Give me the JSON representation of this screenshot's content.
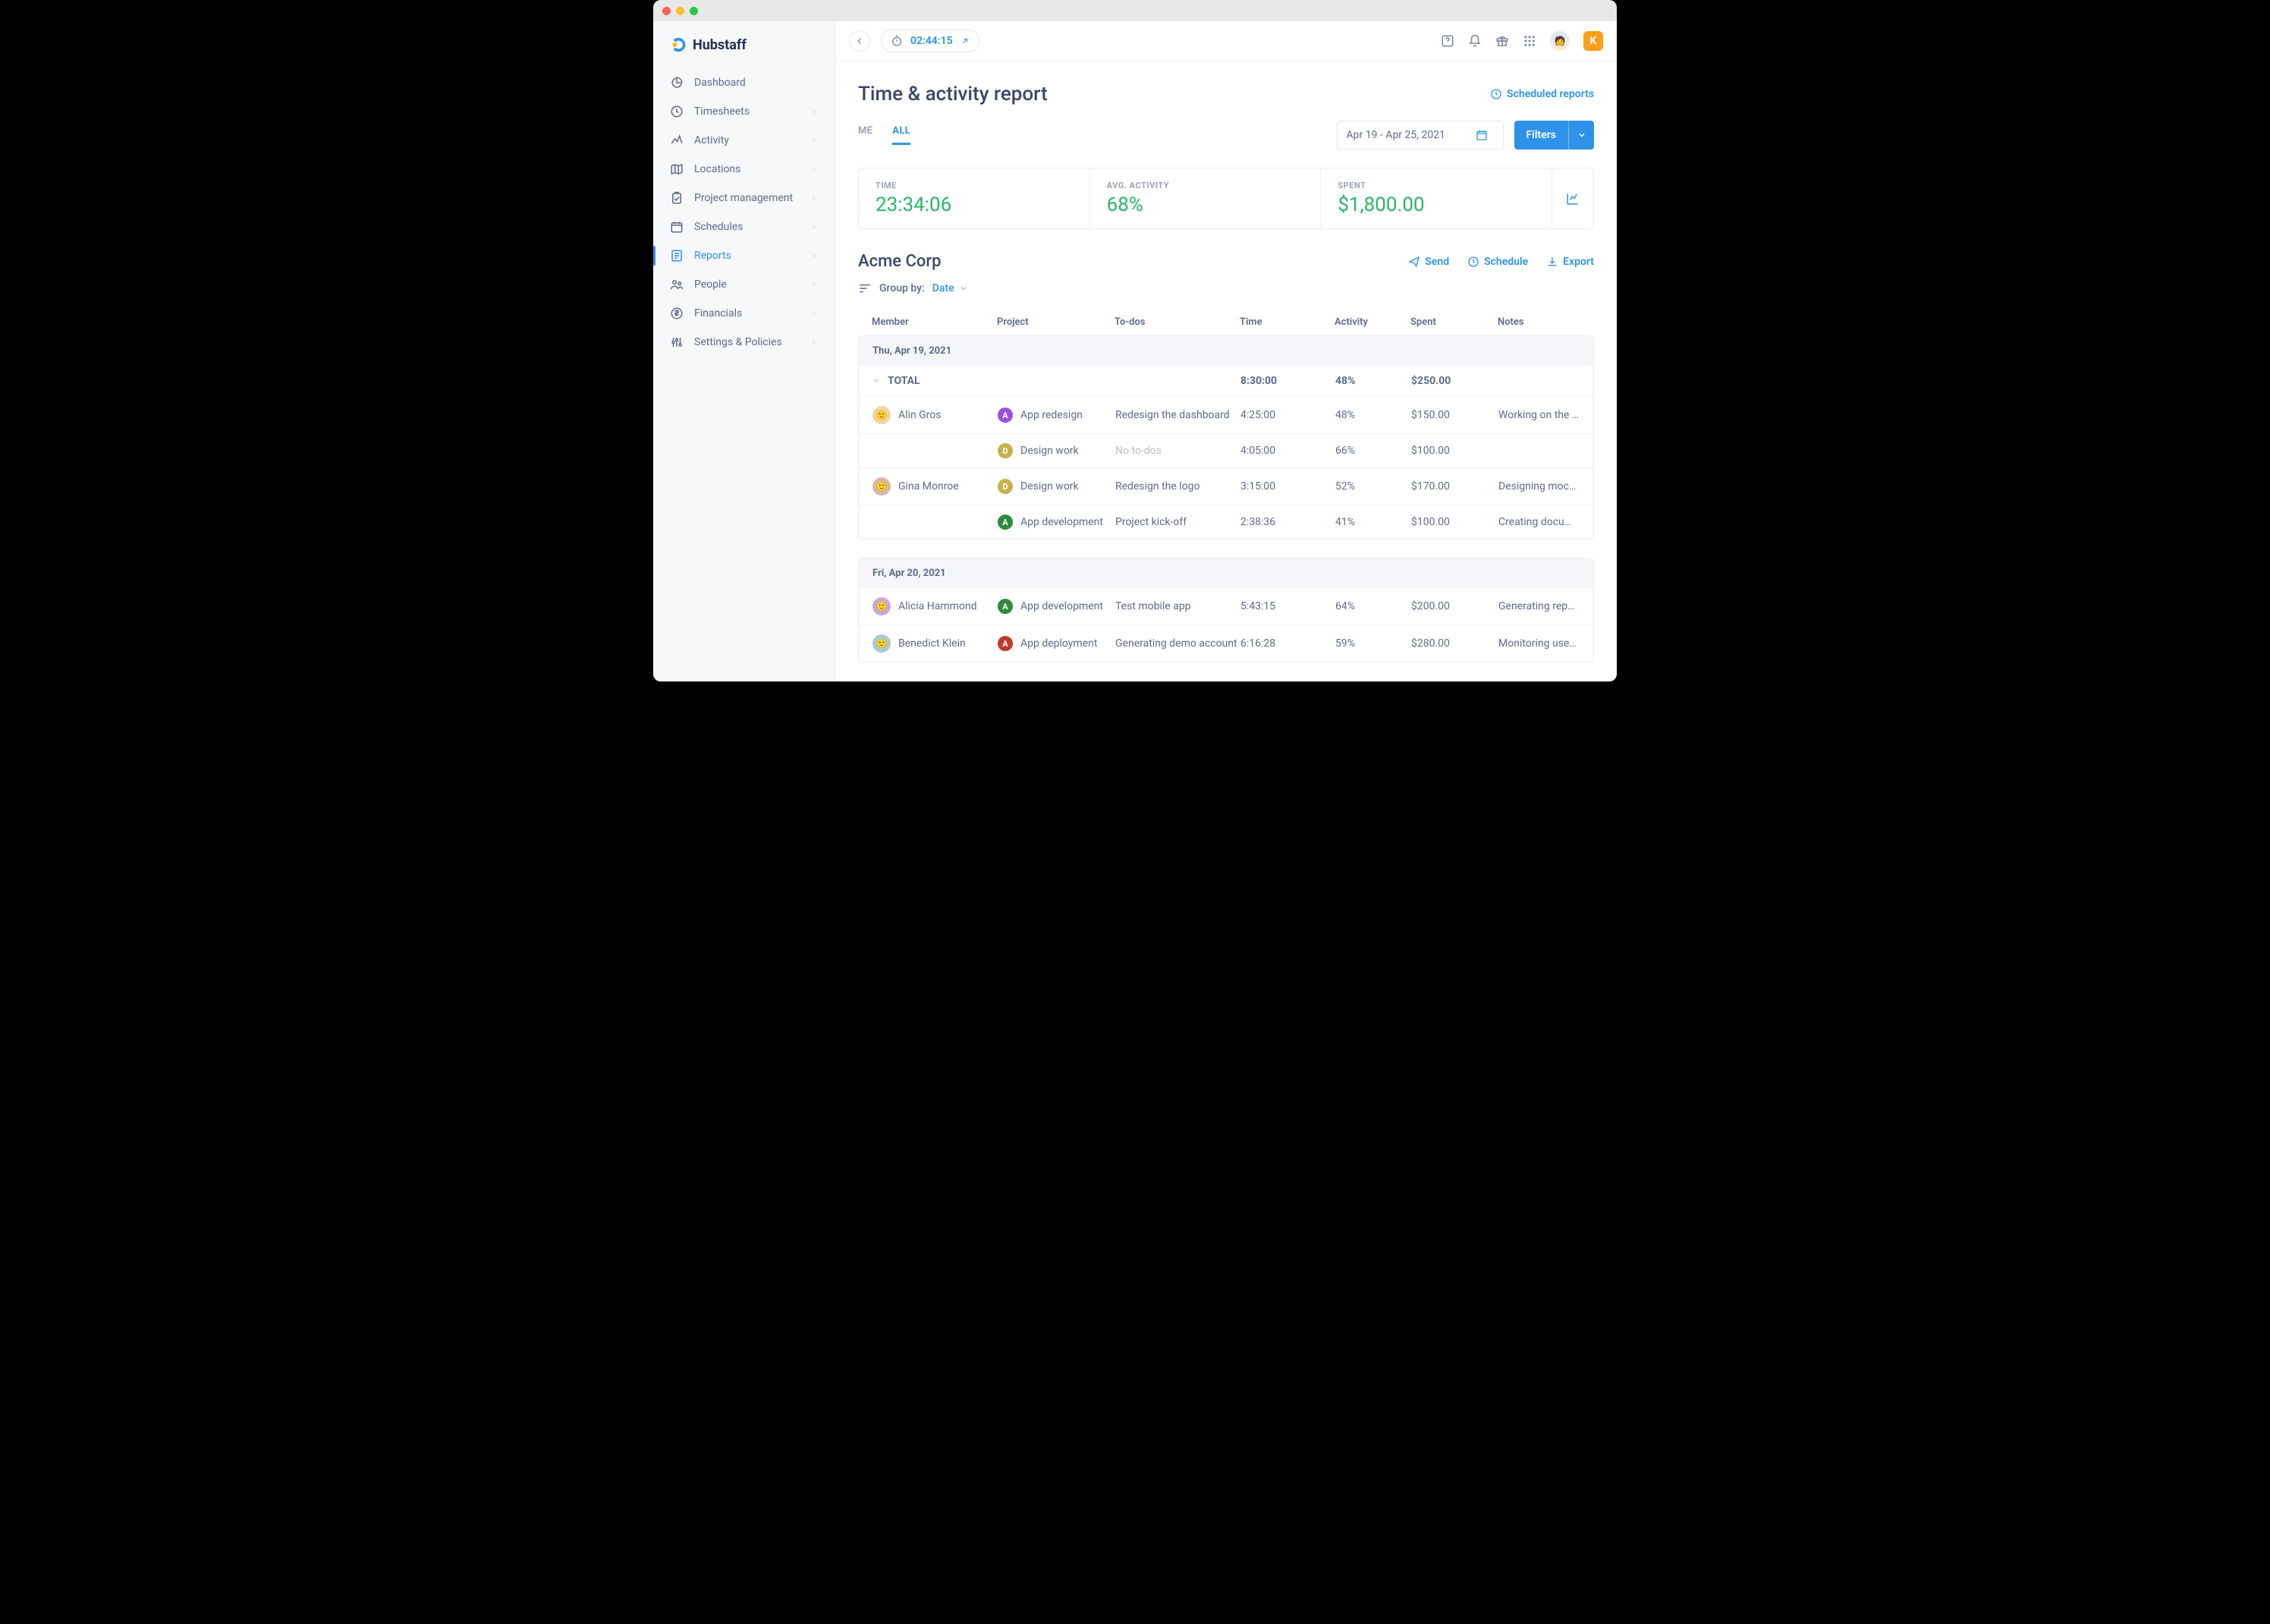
{
  "brand": "Hubstaff",
  "sidebar": {
    "items": [
      {
        "label": "Dashboard",
        "icon": "gauge-icon",
        "expandable": false,
        "active": false
      },
      {
        "label": "Timesheets",
        "icon": "clock-icon",
        "expandable": true,
        "active": false
      },
      {
        "label": "Activity",
        "icon": "activity-icon",
        "expandable": true,
        "active": false
      },
      {
        "label": "Locations",
        "icon": "map-icon",
        "expandable": true,
        "active": false
      },
      {
        "label": "Project management",
        "icon": "clipboard-check-icon",
        "expandable": true,
        "active": false
      },
      {
        "label": "Schedules",
        "icon": "calendar-icon",
        "expandable": true,
        "active": false
      },
      {
        "label": "Reports",
        "icon": "report-icon",
        "expandable": true,
        "active": true
      },
      {
        "label": "People",
        "icon": "people-icon",
        "expandable": true,
        "active": false
      },
      {
        "label": "Financials",
        "icon": "financials-icon",
        "expandable": true,
        "active": false
      },
      {
        "label": "Settings & Policies",
        "icon": "sliders-icon",
        "expandable": true,
        "active": false
      }
    ]
  },
  "topbar": {
    "timer": "02:44:15",
    "user_initial": "K"
  },
  "page": {
    "title": "Time & activity report",
    "scheduled_link": "Scheduled reports",
    "tabs": {
      "me": "ME",
      "all": "ALL"
    },
    "date_range": "Apr 19 - Apr 25, 2021",
    "filters_label": "Filters"
  },
  "summary": {
    "time_label": "TIME",
    "time_value": "23:34:06",
    "activity_label": "AVG. ACTIVITY",
    "activity_value": "68%",
    "spent_label": "SPENT",
    "spent_value": "$1,800.00"
  },
  "org": {
    "name": "Acme Corp",
    "actions": {
      "send": "Send",
      "schedule": "Schedule",
      "export": "Export"
    }
  },
  "groupby": {
    "label": "Group by:",
    "value": "Date"
  },
  "columns": {
    "member": "Member",
    "project": "Project",
    "todos": "To-dos",
    "time": "Time",
    "activity": "Activity",
    "spent": "Spent",
    "notes": "Notes"
  },
  "total_label": "TOTAL",
  "project_colors": {
    "App redesign": "#9b51e0",
    "Design work": "#c7b24d",
    "App development": "#2e8b3d",
    "App deployment": "#c0392b"
  },
  "avatar_colors": {
    "Alin Gros": "#f2d6a2",
    "Gina Monroe": "#d9b8a5",
    "Alicia Hammond": "#c9a8d6",
    "Benedict Klein": "#a8c9d6"
  },
  "days": [
    {
      "date": "Thu, Apr 19, 2021",
      "total": {
        "time": "8:30:00",
        "activity": "48%",
        "spent": "$250.00"
      },
      "rows": [
        {
          "member": "Alin Gros",
          "project": "App redesign",
          "todo": "Redesign the dashboard",
          "time": "4:25:00",
          "activity": "48%",
          "spent": "$150.00",
          "notes": "Working on the tabs"
        },
        {
          "member": "",
          "project": "Design work",
          "todo": "No to-dos",
          "todo_muted": true,
          "time": "4:05:00",
          "activity": "66%",
          "spent": "$100.00",
          "notes": ""
        },
        {
          "member": "Gina Monroe",
          "project": "Design work",
          "todo": "Redesign the logo",
          "time": "3:15:00",
          "activity": "52%",
          "spent": "$170.00",
          "notes": "Designing mockups"
        },
        {
          "member": "",
          "project": "App development",
          "todo": "Project kick-off",
          "time": "2:38:36",
          "activity": "41%",
          "spent": "$100.00",
          "notes": "Creating documentation"
        }
      ]
    },
    {
      "date": "Fri, Apr 20, 2021",
      "rows": [
        {
          "member": "Alicia Hammond",
          "project": "App development",
          "todo": "Test mobile app",
          "time": "5:43:15",
          "activity": "64%",
          "spent": "$200.00",
          "notes": "Generating report"
        },
        {
          "member": "Benedict Klein",
          "project": "App deployment",
          "todo": "Generating demo account",
          "time": "6:16:28",
          "activity": "59%",
          "spent": "$280.00",
          "notes": "Monitoring user feedback"
        }
      ]
    }
  ]
}
